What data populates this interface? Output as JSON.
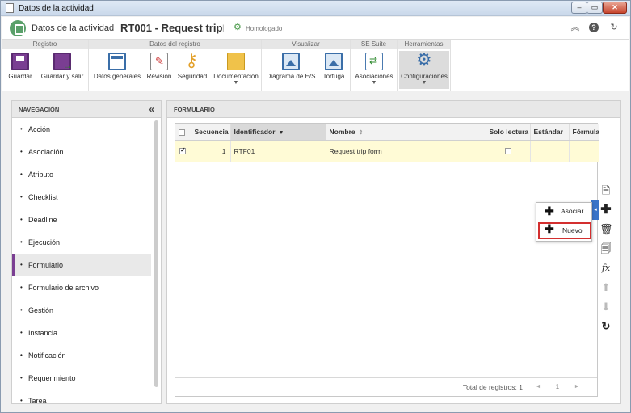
{
  "window": {
    "title": "Datos de la actividad"
  },
  "header": {
    "section": "Datos de la actividad",
    "record": "RT001 - Request trip",
    "separator": "|",
    "status": "Homologado"
  },
  "ribbon": {
    "groups": [
      {
        "title": "Registro",
        "buttons": [
          "Guardar",
          "Guardar y salir"
        ]
      },
      {
        "title": "Datos del registro",
        "buttons": [
          "Datos generales",
          "Revisión",
          "Seguridad",
          "Documentación"
        ]
      },
      {
        "title": "Visualizar",
        "buttons": [
          "Diagrama de E/S",
          "Tortuga"
        ]
      },
      {
        "title": "SE Suite",
        "buttons": [
          "Asociaciones"
        ]
      },
      {
        "title": "Herramientas",
        "buttons": [
          "Configuraciones"
        ]
      }
    ]
  },
  "nav": {
    "title": "NAVEGACIÓN",
    "items": [
      "Acción",
      "Asociación",
      "Atributo",
      "Checklist",
      "Deadline",
      "Ejecución",
      "Formulario",
      "Formulario de archivo",
      "Gestión",
      "Instancia",
      "Notificación",
      "Requerimiento",
      "Tarea"
    ],
    "active": "Formulario"
  },
  "panel": {
    "title": "FORMULARIO",
    "columns": [
      "Secuencia",
      "Identificador",
      "Nombre",
      "Solo lectura",
      "Estándar",
      "Fórmula"
    ],
    "rows": [
      {
        "sequence": "1",
        "id": "RTF01",
        "name": "Request trip form",
        "readonly": false,
        "selected": true
      }
    ],
    "footer": {
      "total": "Total de registros: 1",
      "page": "1"
    }
  },
  "popup_menu": {
    "items": [
      "Asociar",
      "Nuevo"
    ],
    "highlighted": "Nuevo"
  },
  "colors": {
    "accent": "#7a3e92",
    "highlight_border": "#d32f2f",
    "selected_row": "#fffbd6"
  }
}
